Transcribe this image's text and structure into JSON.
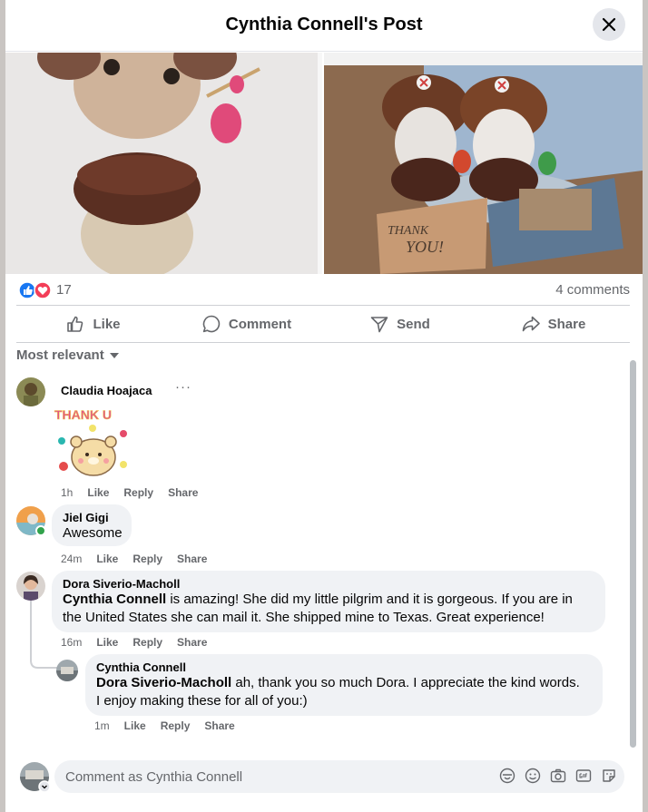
{
  "header": {
    "title": "Cynthia Connell's Post"
  },
  "photos": {
    "right_card_text": [
      "THANK",
      "YOU!"
    ]
  },
  "stats": {
    "reaction_count": "17",
    "comments_count": "4 comments"
  },
  "actions": [
    {
      "label": "Like",
      "icon": "thumbs-up-icon"
    },
    {
      "label": "Comment",
      "icon": "comment-icon"
    },
    {
      "label": "Send",
      "icon": "send-icon"
    },
    {
      "label": "Share",
      "icon": "share-icon"
    }
  ],
  "sort": {
    "label": "Most relevant"
  },
  "comments": [
    {
      "author": "Claudia Hoajaca",
      "sticker_text": "THANK U",
      "time": "1h",
      "like": "Like",
      "reply": "Reply",
      "share": "Share"
    },
    {
      "author": "Jiel Gigi",
      "text": "Awesome",
      "time": "24m",
      "like": "Like",
      "reply": "Reply",
      "share": "Share"
    },
    {
      "author": "Dora Siverio-Macholl",
      "mention": "Cynthia Connell",
      "text_line1": " is amazing! She did my little pilgrim and it is gorgeous. If you are in",
      "text_line2": "the United States she can mail it. She shipped mine to Texas. Great experience!",
      "time": "16m",
      "like": "Like",
      "reply": "Reply",
      "share": "Share"
    },
    {
      "author": "Cynthia Connell",
      "mention": "Dora Siverio-Macholl",
      "text_line1": " ah, thank you so much Dora. I appreciate the kind words.",
      "text_line2": "I enjoy making these for all of you:)",
      "time": "1m",
      "like": "Like",
      "reply": "Reply",
      "share": "Share"
    }
  ],
  "composer": {
    "placeholder": "Comment as Cynthia Connell"
  },
  "colors": {
    "like_blue": "#1877f2",
    "love_red": "#f33e58",
    "text_secondary": "#65676b",
    "bubble": "#f0f2f5"
  }
}
